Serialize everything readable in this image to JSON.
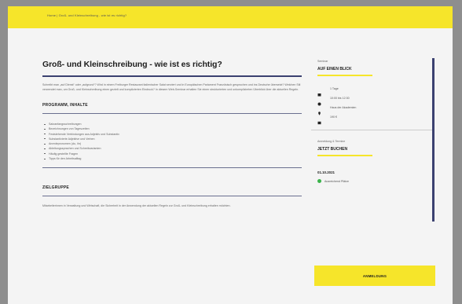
{
  "topbar": {
    "breadcrumb": "Home | Groß- und Kleinschreibung - wie ist es richtig?"
  },
  "main": {
    "title": "Groß- und Kleinschreibung - wie ist es richtig?",
    "intro": "Schreibt man „auf Dienst“ oder „aufgrund“? Wird in einem Freiburger Restaurant italienischer Salat serviert und in Europäischen Parlament Französisch gesprochen und ins Deutsche übersetzt? Welchen Stil verwendet man, um Groß- und Kleinschreibung einen gezielt und komplizierten Eindruck? In diesem Web-Seminar erhalten Sie einen strukturierten und unkomplizierten Überblick über die aktuellen Regeln.",
    "section_program": "PROGRAMM, INHALTE",
    "program_items": [
      "Satzanfangsschreibungen",
      "Bezeichnungen von Tageszeiten",
      "Feststehende Verbindungen aus Adjektiv und Substantiv",
      "Substantivierte Adjektive und Verben",
      "Anredepronomen (du, ihr)",
      "Ableitungssprachen und Schreibvarianten",
      "Häufig gestellte Fragen",
      "Tipps für den Arbeitsalltag"
    ],
    "section_target": "ZIELGRUPPE",
    "target_text": "Mitarbeiterinnen in Verwaltung und Wirtschaft, die Sicherheit in der Anwendung der aktuellen Regeln zur Groß- und Kleinschreibung erhalten möchten."
  },
  "sidebar": {
    "overview": {
      "eyebrow": "Seminar",
      "title": "AUF EINEN BLICK",
      "details": [
        {
          "icon": "calendar-icon",
          "text": "1 Tage"
        },
        {
          "icon": "clock-icon",
          "text": "10:00 bis 12:30"
        },
        {
          "icon": "location-icon",
          "text": "Haus der Akademien"
        },
        {
          "icon": "price-icon",
          "text": "190 €"
        }
      ]
    },
    "booking": {
      "eyebrow": "Anmeldung & Termine",
      "title": "JETZT BUCHEN",
      "date": "01.10.2021",
      "status": "Ausreichend Plätze"
    },
    "register_label": "ANMELDUNG"
  }
}
